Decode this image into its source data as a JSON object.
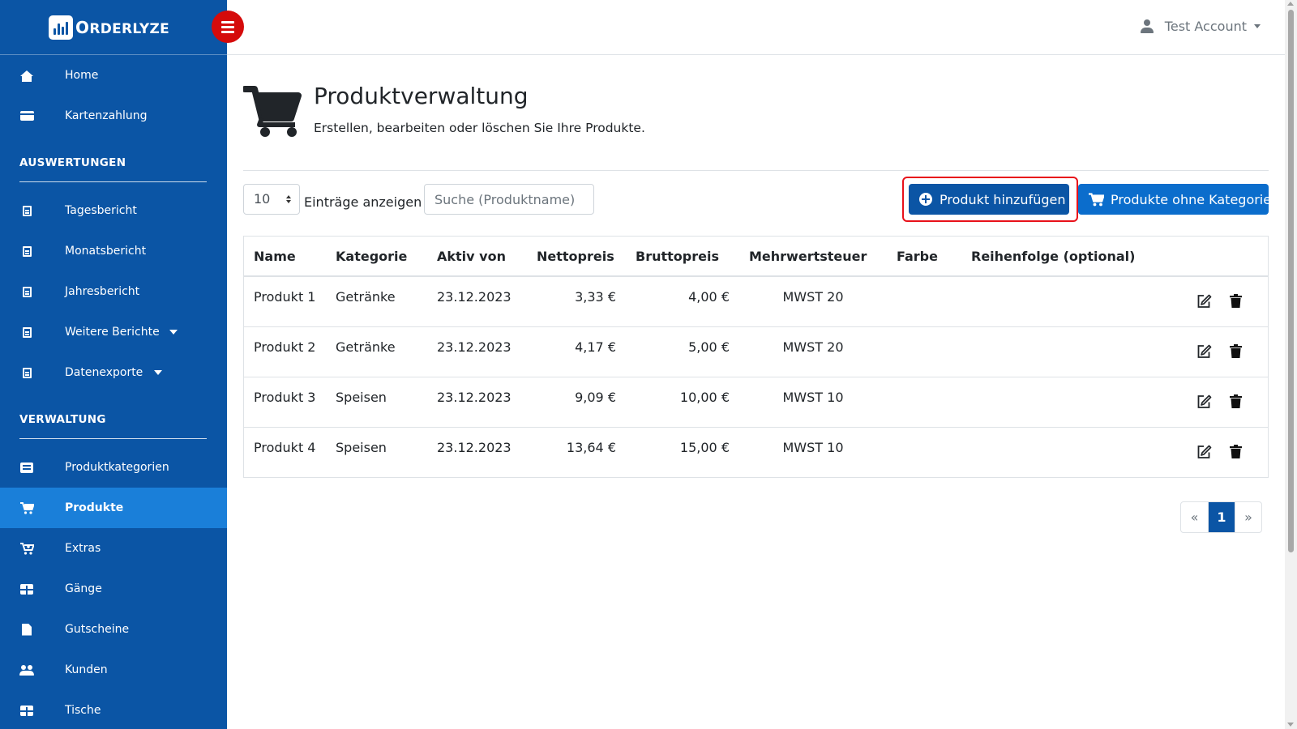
{
  "brand": {
    "name_prefix": "O",
    "name_rest": "RDERLYZE"
  },
  "sidebar": {
    "top_items": [
      {
        "label": "Home",
        "icon": "home-icon"
      },
      {
        "label": "Kartenzahlung",
        "icon": "credit-card-icon"
      }
    ],
    "sections": [
      {
        "title": "AUSWERTUNGEN",
        "items": [
          {
            "label": "Tagesbericht",
            "icon": "document-icon"
          },
          {
            "label": "Monatsbericht",
            "icon": "document-icon"
          },
          {
            "label": "Jahresbericht",
            "icon": "document-icon"
          },
          {
            "label": "Weitere Berichte",
            "icon": "document-icon",
            "dropdown": true
          },
          {
            "label": "Datenexporte",
            "icon": "document-icon",
            "dropdown": true
          }
        ]
      },
      {
        "title": "VERWALTUNG",
        "items": [
          {
            "label": "Produktkategorien",
            "icon": "list-icon"
          },
          {
            "label": "Produkte",
            "icon": "cart-icon",
            "active": true
          },
          {
            "label": "Extras",
            "icon": "cart-plus-icon"
          },
          {
            "label": "Gänge",
            "icon": "grid-icon"
          },
          {
            "label": "Gutscheine",
            "icon": "file-icon"
          },
          {
            "label": "Kunden",
            "icon": "users-icon"
          },
          {
            "label": "Tische",
            "icon": "table-icon"
          }
        ]
      }
    ]
  },
  "topbar": {
    "account_label": "Test Account"
  },
  "page": {
    "title": "Produktverwaltung",
    "subtitle": "Erstellen, bearbeiten oder löschen Sie Ihre Produkte."
  },
  "controls": {
    "page_length": "10",
    "page_length_label": "Einträge anzeigen",
    "search_placeholder": "Suche (Produktname)",
    "add_button": "Produkt hinzufügen",
    "no_category_button": "Produkte ohne Kategorie"
  },
  "table": {
    "columns": [
      "Name",
      "Kategorie",
      "Aktiv von",
      "Nettopreis",
      "Bruttopreis",
      "Mehrwertsteuer",
      "Farbe",
      "Reihenfolge (optional)"
    ],
    "rows": [
      {
        "name": "Produkt 1",
        "category": "Getränke",
        "active_from": "23.12.2023",
        "net": "3,33 €",
        "gross": "4,00 €",
        "vat": "MWST 20",
        "color": "",
        "order": ""
      },
      {
        "name": "Produkt 2",
        "category": "Getränke",
        "active_from": "23.12.2023",
        "net": "4,17 €",
        "gross": "5,00 €",
        "vat": "MWST 20",
        "color": "",
        "order": ""
      },
      {
        "name": "Produkt 3",
        "category": "Speisen",
        "active_from": "23.12.2023",
        "net": "9,09 €",
        "gross": "10,00 €",
        "vat": "MWST 10",
        "color": "",
        "order": ""
      },
      {
        "name": "Produkt 4",
        "category": "Speisen",
        "active_from": "23.12.2023",
        "net": "13,64 €",
        "gross": "15,00 €",
        "vat": "MWST 10",
        "color": "",
        "order": ""
      }
    ]
  },
  "pagination": {
    "prev": "«",
    "current": "1",
    "next": "»"
  },
  "colors": {
    "sidebar": "#0b55a5",
    "active_item": "#1a7fd9",
    "toggle": "#d50b0b",
    "highlight": "#e8111a"
  }
}
